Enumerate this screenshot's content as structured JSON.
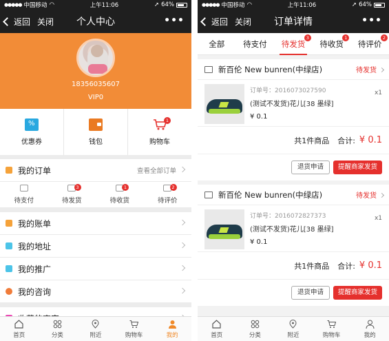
{
  "status": {
    "carrier": "中国移动",
    "time": "上午11:06",
    "battery": "64%"
  },
  "left": {
    "nav": {
      "back": "返回",
      "close": "关闭",
      "title": "个人中心",
      "more": "•••"
    },
    "profile": {
      "phone": "18356035607",
      "level": "VIP0"
    },
    "quick": [
      {
        "label": "优惠券"
      },
      {
        "label": "钱包"
      },
      {
        "label": "购物车",
        "badge": "1"
      }
    ],
    "my_orders": {
      "label": "我的订单",
      "view_all": "查看全部订单"
    },
    "order_status": [
      {
        "label": "待支付",
        "badge": ""
      },
      {
        "label": "待发货",
        "badge": "3"
      },
      {
        "label": "待收货",
        "badge": "1"
      },
      {
        "label": "待评价",
        "badge": "2"
      }
    ],
    "menu": [
      {
        "label": "我的账单",
        "color": "#f5a23a"
      },
      {
        "label": "我的地址",
        "color": "#4cc4e8"
      },
      {
        "label": "我的推广",
        "color": "#4cc4e8"
      },
      {
        "label": "我的咨询",
        "color": "#f07c3a"
      },
      {
        "label": "收藏的商家",
        "color": "#ea4ab4"
      }
    ],
    "tabbar": [
      {
        "label": "首页"
      },
      {
        "label": "分类"
      },
      {
        "label": "附近"
      },
      {
        "label": "购物车"
      },
      {
        "label": "我的",
        "active": true
      }
    ]
  },
  "right": {
    "nav": {
      "back": "返回",
      "close": "关闭",
      "title": "订单详情",
      "more": "•••"
    },
    "tabs": [
      {
        "label": "全部",
        "badge": ""
      },
      {
        "label": "待支付",
        "badge": ""
      },
      {
        "label": "待发货",
        "badge": "3",
        "active": true
      },
      {
        "label": "待收货",
        "badge": "1"
      },
      {
        "label": "待评价",
        "badge": "2"
      }
    ],
    "orders": [
      {
        "shop": "新百伦 New bunren(中绿店)",
        "status": "待发货",
        "order_no": "订单号：2016073027590",
        "name": "(测试不发货)花儿[38 墨绿]",
        "price": "¥ 0.1",
        "qty": "x1",
        "total_count": "共1件商品",
        "total_label": "合计:",
        "total_amount": "¥ 0.1",
        "btn_return": "退货申请",
        "btn_remind": "提醒商家发货"
      },
      {
        "shop": "新百伦 New bunren(中绿店)",
        "status": "待发货",
        "order_no": "订单号：2016072827373",
        "name": "(测试不发货)花儿[38 墨绿]",
        "price": "¥ 0.1",
        "qty": "x1",
        "total_count": "共1件商品",
        "total_label": "合计:",
        "total_amount": "¥ 0.1",
        "btn_return": "退货申请",
        "btn_remind": "提醒商家发货"
      }
    ],
    "tabbar": [
      {
        "label": "首页"
      },
      {
        "label": "分类"
      },
      {
        "label": "附近"
      },
      {
        "label": "购物车"
      },
      {
        "label": "我的"
      }
    ]
  }
}
